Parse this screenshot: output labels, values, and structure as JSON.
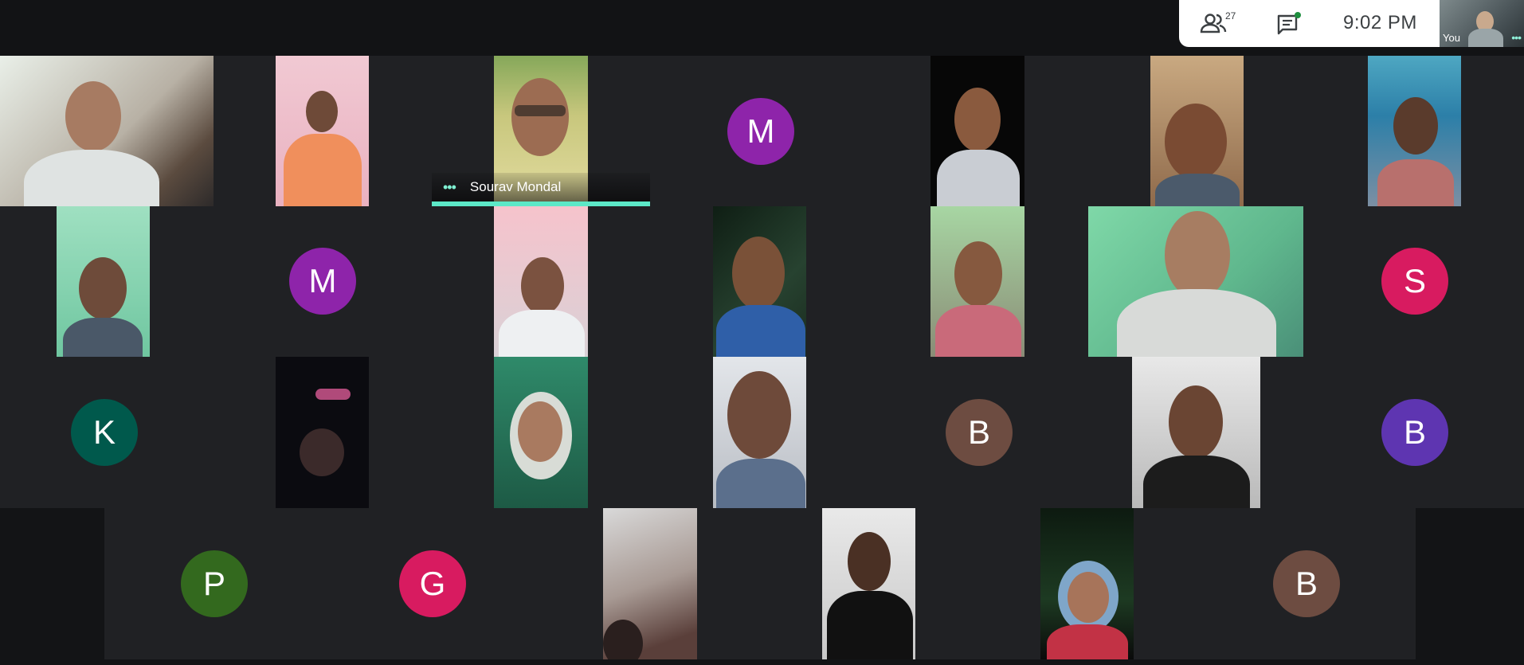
{
  "toolbar": {
    "participants_count": "27",
    "time": "9:02  PM",
    "self_label": "You",
    "colors": {
      "pill_bg": "#ffffff",
      "icon": "#3c4043",
      "notify_dot": "#1e8e3e"
    }
  },
  "participants": {
    "r1c4_initial": "M",
    "r2c2_initial": "M",
    "r2c7_initial": "S",
    "r3c1_initial": "K",
    "r3c5_initial": "B",
    "r3c7_initial": "B",
    "r4c1_initial": "P",
    "r4c2_initial": "G",
    "r4c6_initial": "B",
    "active_speaker_name": "Sourav Mondal"
  },
  "colors": {
    "background": "#131416",
    "tile": "#202124",
    "speaking_bar": "#5ce8c7",
    "avatar_purple": "#8e24aa",
    "avatar_pink": "#d81b60",
    "avatar_teal": "#00594c",
    "avatar_brown": "#6d4c41",
    "avatar_indigo": "#5e35b1",
    "avatar_green": "#33691e"
  }
}
